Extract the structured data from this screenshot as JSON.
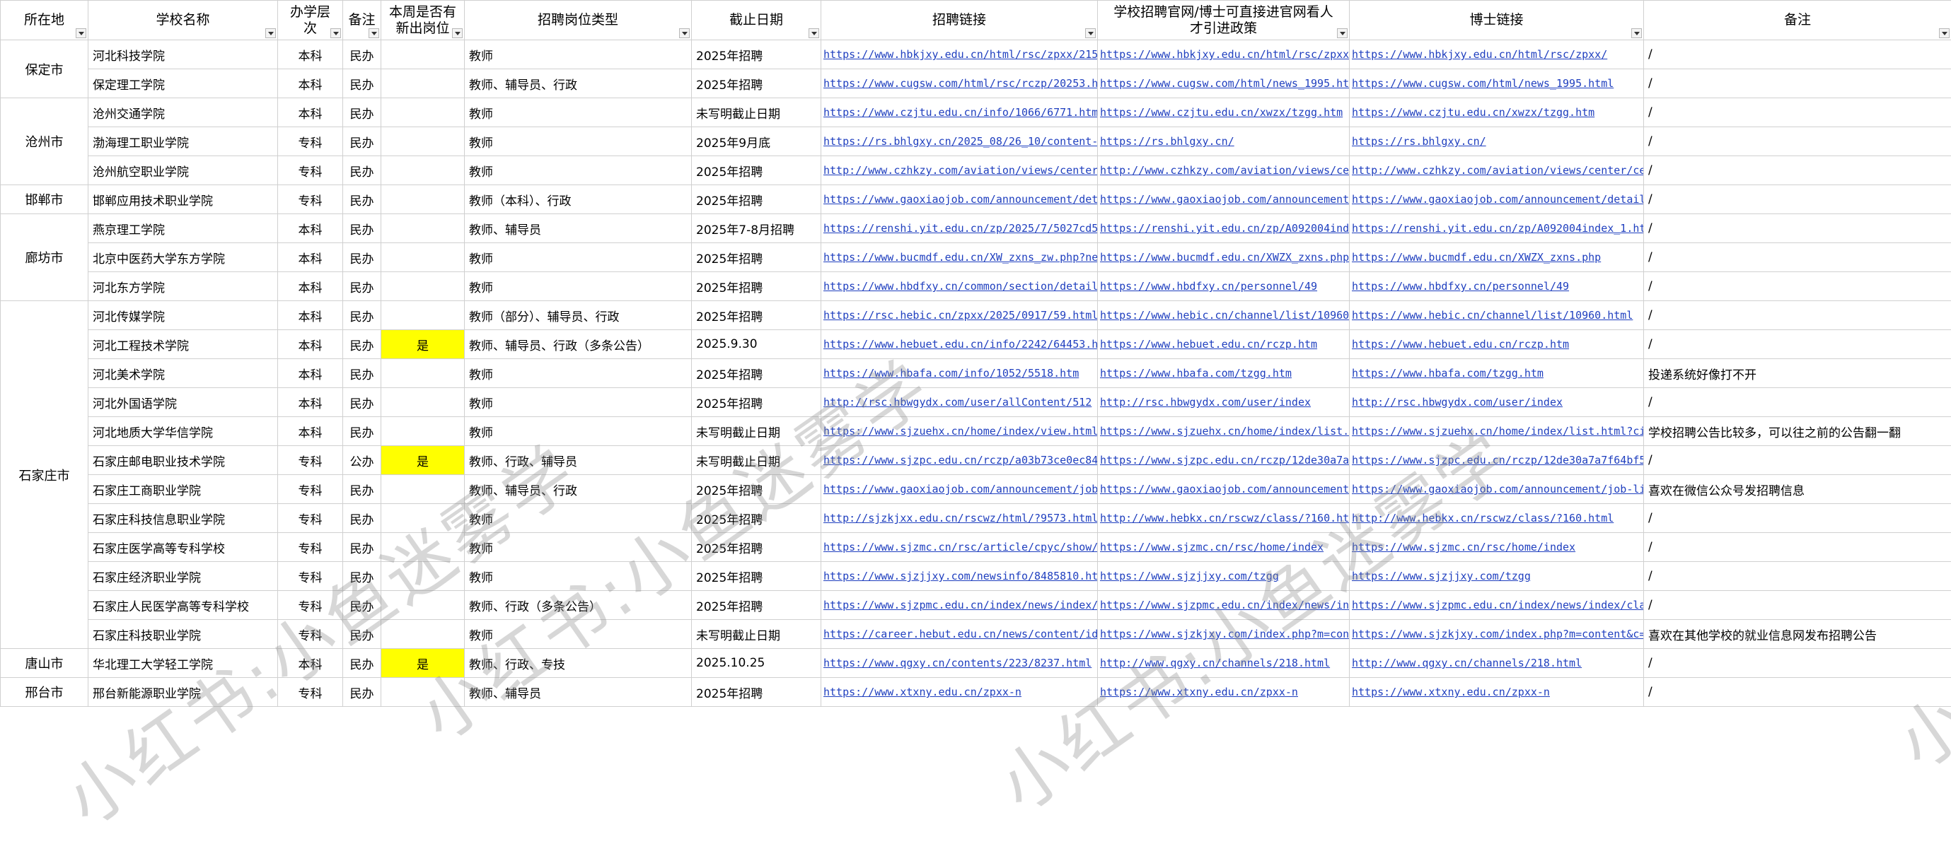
{
  "headers": {
    "city": "所在地",
    "school": "学校名称",
    "level": "办学层次",
    "note1": "备注",
    "new_post": "本周是否有新出岗位",
    "post_type": "招聘岗位类型",
    "deadline": "截止日期",
    "recruit_link": "招聘链接",
    "official_site": "学校招聘官网/博士可直接进官网看人才引进政策",
    "phd_link": "博士链接",
    "remark": "备注"
  },
  "cities": [
    "保定市",
    "沧州市",
    "邯郸市",
    "廊坊市",
    "石家庄市",
    "唐山市",
    "邢台市"
  ],
  "rows": [
    {
      "school": "河北科技学院",
      "level": "本科",
      "note1": "民办",
      "new": "",
      "post": "教师",
      "deadline": "2025年招聘",
      "link": "https://www.hbkjxy.edu.cn/html/rsc/zpxx/215",
      "site": "https://www.hbkjxy.edu.cn/html/rsc/zpxx",
      "phd": "https://www.hbkjxy.edu.cn/html/rsc/zpxx/",
      "remark": "/"
    },
    {
      "school": "保定理工学院",
      "level": "本科",
      "note1": "民办",
      "new": "",
      "post": "教师、辅导员、行政",
      "deadline": "2025年招聘",
      "link": "https://www.cugsw.com/html/rsc/rczp/20253.h",
      "site": "https://www.cugsw.com/html/news_1995.ht",
      "phd": "https://www.cugsw.com/html/news_1995.html",
      "remark": "/"
    },
    {
      "school": "沧州交通学院",
      "level": "本科",
      "note1": "民办",
      "new": "",
      "post": "教师",
      "deadline": "未写明截止日期",
      "link": "https://www.czjtu.edu.cn/info/1066/6771.htm",
      "site": "https://www.czjtu.edu.cn/xwzx/tzgg.htm",
      "phd": "https://www.czjtu.edu.cn/xwzx/tzgg.htm",
      "remark": "/"
    },
    {
      "school": "渤海理工职业学院",
      "level": "专科",
      "note1": "民办",
      "new": "",
      "post": "教师",
      "deadline": "2025年9月底",
      "link": "https://rs.bhlgxy.cn/2025_08/26_10/content-",
      "site": "https://rs.bhlgxy.cn/",
      "phd": "https://rs.bhlgxy.cn/",
      "remark": "/"
    },
    {
      "school": "沧州航空职业学院",
      "level": "专科",
      "note1": "民办",
      "new": "",
      "post": "教师",
      "deadline": "2025年招聘",
      "link": "http://www.czhkzy.com/aviation/views/center",
      "site": "http://www.czhkzy.com/aviation/views/ce",
      "phd": "http://www.czhkzy.com/aviation/views/center/ce",
      "remark": "/"
    },
    {
      "school": "邯郸应用技术职业学院",
      "level": "专科",
      "note1": "民办",
      "new": "",
      "post": "教师（本科）、行政",
      "deadline": "2025年招聘",
      "link": "https://www.gaoxiaojob.com/announcement/det",
      "site": "https://www.gaoxiaojob.com/announcement",
      "phd": "https://www.gaoxiaojob.com/announcement/detail",
      "remark": "/"
    },
    {
      "school": "燕京理工学院",
      "level": "本科",
      "note1": "民办",
      "new": "",
      "post": "教师、辅导员",
      "deadline": "2025年7-8月招聘",
      "link": "https://renshi.yit.edu.cn/zp/2025/7/5027cd5",
      "site": "https://renshi.yit.edu.cn/zp/A092004ind",
      "phd": "https://renshi.yit.edu.cn/zp/A092004index_1.ht",
      "remark": "/"
    },
    {
      "school": "北京中医药大学东方学院",
      "level": "本科",
      "note1": "民办",
      "new": "",
      "post": "教师",
      "deadline": "2025年招聘",
      "link": "https://www.bucmdf.edu.cn/XW_zxns_zw.php?ne",
      "site": "https://www.bucmdf.edu.cn/XWZX_zxns.php",
      "phd": "https://www.bucmdf.edu.cn/XWZX_zxns.php",
      "remark": "/"
    },
    {
      "school": "河北东方学院",
      "level": "本科",
      "note1": "民办",
      "new": "",
      "post": "教师",
      "deadline": "2025年招聘",
      "link": "https://www.hbdfxy.cn/common/section/detail",
      "site": "https://www.hbdfxy.cn/personnel/49",
      "phd": "https://www.hbdfxy.cn/personnel/49",
      "remark": "/"
    },
    {
      "school": "河北传媒学院",
      "level": "本科",
      "note1": "民办",
      "new": "",
      "post": "教师（部分）、辅导员、行政",
      "deadline": "2025年招聘",
      "link": "https://rsc.hebic.cn/zpxx/2025/0917/59.html",
      "site": "https://www.hebic.cn/channel/list/10960",
      "phd": "https://www.hebic.cn/channel/list/10960.html",
      "remark": "/"
    },
    {
      "school": "河北工程技术学院",
      "level": "本科",
      "note1": "民办",
      "new": "是",
      "post": "教师、辅导员、行政（多条公告）",
      "deadline": "2025.9.30",
      "link": "https://www.hebuet.edu.cn/info/2242/64453.h",
      "site": "https://www.hebuet.edu.cn/rczp.htm",
      "phd": "https://www.hebuet.edu.cn/rczp.htm",
      "remark": "/"
    },
    {
      "school": "河北美术学院",
      "level": "本科",
      "note1": "民办",
      "new": "",
      "post": "教师",
      "deadline": "2025年招聘",
      "link": "https://www.hbafa.com/info/1052/5518.htm",
      "site": "https://www.hbafa.com/tzgg.htm",
      "phd": "https://www.hbafa.com/tzgg.htm",
      "remark": "投递系统好像打不开"
    },
    {
      "school": "河北外国语学院",
      "level": "本科",
      "note1": "民办",
      "new": "",
      "post": "教师",
      "deadline": "2025年招聘",
      "link": "http://rsc.hbwgydx.com/user/allContent/512",
      "site": "http://rsc.hbwgydx.com/user/index",
      "phd": "http://rsc.hbwgydx.com/user/index",
      "remark": "/"
    },
    {
      "school": "河北地质大学华信学院",
      "level": "本科",
      "note1": "民办",
      "new": "",
      "post": "教师",
      "deadline": "未写明截止日期",
      "link": "https://www.sjzuehx.cn/home/index/view.html?",
      "site": "https://www.sjzuehx.cn/home/index/list.h",
      "phd": "https://www.sjzuehx.cn/home/index/list.html?cid",
      "remark": "学校招聘公告比较多，可以往之前的公告翻一翻"
    },
    {
      "school": "石家庄邮电职业技术学院",
      "level": "专科",
      "note1": "公办",
      "new": "是",
      "post": "教师、行政、辅导员",
      "deadline": "未写明截止日期",
      "link": "https://www.sjzpc.edu.cn/rczp/a03b73ce0ec84",
      "site": "https://www.sjzpc.edu.cn/rczp/12de30a7a",
      "phd": "https://www.sjzpc.edu.cn/rczp/12de30a7a7f64bf5",
      "remark": "/"
    },
    {
      "school": "石家庄工商职业学院",
      "level": "专科",
      "note1": "民办",
      "new": "",
      "post": "教师、辅导员、行政",
      "deadline": "2025年招聘",
      "link": "https://www.gaoxiaojob.com/announcement/job",
      "site": "https://www.gaoxiaojob.com/announcement",
      "phd": "https://www.gaoxiaojob.com/announcement/job-li",
      "remark": "喜欢在微信公众号发招聘信息"
    },
    {
      "school": "石家庄科技信息职业学院",
      "level": "专科",
      "note1": "民办",
      "new": "",
      "post": "教师",
      "deadline": "2025年招聘",
      "link": "http://sjzkjxx.edu.cn/rscwz/html/?9573.html",
      "site": "http://www.hebkx.cn/rscwz/class/?160.ht",
      "phd": "http://www.hebkx.cn/rscwz/class/?160.html",
      "remark": "/"
    },
    {
      "school": "石家庄医学高等专科学校",
      "level": "专科",
      "note1": "民办",
      "new": "",
      "post": "教师",
      "deadline": "2025年招聘",
      "link": "https://www.sjzmc.cn/rsc/article/cpyc/show/",
      "site": "https://www.sjzmc.cn/rsc/home/index",
      "phd": "https://www.sjzmc.cn/rsc/home/index",
      "remark": "/"
    },
    {
      "school": "石家庄经济职业学院",
      "level": "专科",
      "note1": "民办",
      "new": "",
      "post": "教师",
      "deadline": "2025年招聘",
      "link": "https://www.sjzjjxy.com/newsinfo/8485810.ht",
      "site": "https://www.sjzjjxy.com/tzgg",
      "phd": "https://www.sjzjjxy.com/tzgg",
      "remark": "/"
    },
    {
      "school": "石家庄人民医学高等专科学校",
      "level": "专科",
      "note1": "民办",
      "new": "",
      "post": "教师、行政（多条公告）",
      "deadline": "2025年招聘",
      "link": "https://www.sjzpmc.edu.cn/index/news/index/c",
      "site": "https://www.sjzpmc.edu.cn/index/news/ind",
      "phd": "https://www.sjzpmc.edu.cn/index/news/index/clas",
      "remark": "/"
    },
    {
      "school": "石家庄科技职业学院",
      "level": "专科",
      "note1": "民办",
      "new": "",
      "post": "教师",
      "deadline": "未写明截止日期",
      "link": "https://career.hebut.edu.cn/news/content/id",
      "site": "https://www.sjzkjxy.com/index.php?m=con",
      "phd": "https://www.sjzkjxy.com/index.php?m=content&c=",
      "remark": "喜欢在其他学校的就业信息网发布招聘公告"
    },
    {
      "school": "华北理工大学轻工学院",
      "level": "本科",
      "note1": "民办",
      "new": "是",
      "post": "教师、行政、专技",
      "deadline": "2025.10.25",
      "link": "https://www.qgxy.cn/contents/223/8237.html",
      "site": "http://www.qgxy.cn/channels/218.html",
      "phd": "http://www.qgxy.cn/channels/218.html",
      "remark": "/"
    },
    {
      "school": "邢台新能源职业学院",
      "level": "专科",
      "note1": "民办",
      "new": "",
      "post": "教师、辅导员",
      "deadline": "2025年招聘",
      "link": "https://www.xtxny.edu.cn/zpxx-n",
      "site": "https://www.xtxny.edu.cn/zpxx-n",
      "phd": "https://www.xtxny.edu.cn/zpxx-n",
      "remark": "/"
    }
  ],
  "watermark": "小红书:小鱼迷雾学"
}
